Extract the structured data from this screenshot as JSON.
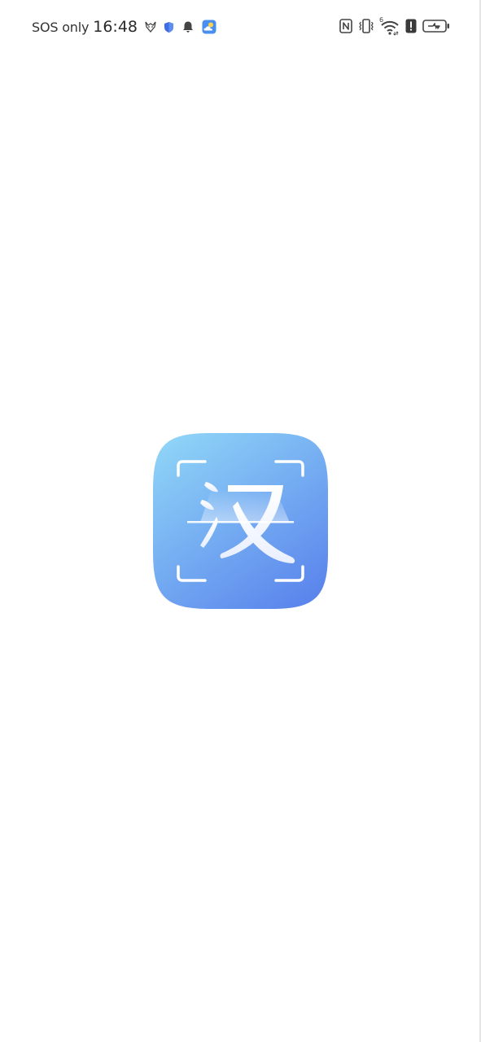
{
  "status_bar": {
    "carrier": "SOS only",
    "time": "16:48",
    "left_icons": [
      "fox-mask-icon",
      "shield-icon",
      "bell-icon",
      "weather-icon"
    ],
    "right_icons": [
      "nfc-icon",
      "vibrate-icon",
      "wifi-icon",
      "alert-icon",
      "battery-charging-icon"
    ],
    "wifi_superscript": "6"
  },
  "splash": {
    "app_icon": "han-character-scan-icon",
    "glyph": "汉",
    "colors": {
      "gradient_top": "#8ed0f6",
      "gradient_bottom": "#5b87ec",
      "glyph_color": "#ffffff"
    }
  }
}
